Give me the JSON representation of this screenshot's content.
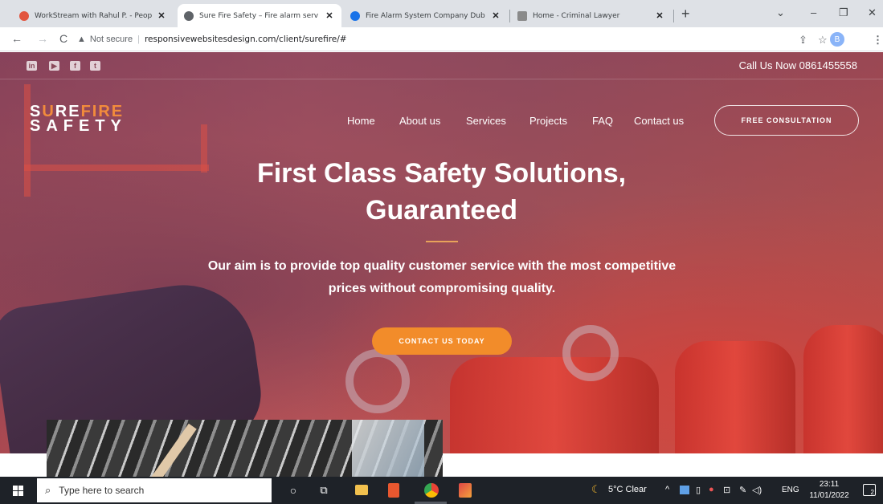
{
  "browser": {
    "tabs": [
      {
        "title": "WorkStream with Rahul P. - Peop",
        "favicon_color": "#e2553f",
        "active": false
      },
      {
        "title": "Sure Fire Safety – Fire alarm serv",
        "favicon_color": "#5f6368",
        "active": true
      },
      {
        "title": "Fire Alarm System Company Dub",
        "favicon_color": "#1a73e8",
        "active": false
      },
      {
        "title": "Home - Criminal Lawyer",
        "favicon_color": "#8a8a8a",
        "active": false
      }
    ],
    "close_glyph": "✕",
    "newtab_glyph": "+",
    "window_controls": {
      "dropdown": "⌄",
      "minimize": "–",
      "restore": "❐",
      "close": "✕"
    },
    "nav": {
      "back": "←",
      "forward": "→",
      "reload": "C"
    },
    "security_icon": "warning-triangle-icon",
    "security_glyph": "▲",
    "security_label": "Not secure",
    "url": "responsivewebsitesdesign.com/client/surefire/#",
    "share_glyph": "⇪",
    "star_glyph": "☆",
    "profile_initial": "B",
    "menu_glyph": "⋮"
  },
  "site": {
    "social_icons": [
      "in",
      "▶",
      "f",
      "t"
    ],
    "call_us": "Call Us Now 0861455558",
    "logo": {
      "line1_a": "S",
      "line1_b": "U",
      "line1_c": "RE",
      "line1_d": "FIRE",
      "line2": "SAFETY"
    },
    "nav": [
      "Home",
      "About us",
      "Services",
      "Projects",
      "FAQ",
      "Contact us"
    ],
    "consult_button": "FREE CONSULTATION",
    "headline_line1": "First Class Safety Solutions,",
    "headline_line2": "Guaranteed",
    "tagline_line1": "Our aim is to provide top quality customer service with the most competitive",
    "tagline_line2": "prices without compromising quality.",
    "cta_button": "CONTACT US TODAY"
  },
  "taskbar": {
    "search_placeholder": "Type here to search",
    "search_glyph": "⌕",
    "weather": "5°C  Clear",
    "weather_glyph": "☾",
    "lang": "ENG",
    "time": "23:11",
    "date": "11/01/2022",
    "notifications": "2",
    "tray_chevron": "^"
  },
  "colors": {
    "accent_orange": "#f28c2a",
    "logo_fire": "#f28b3c",
    "taskbar": "#1e2228"
  }
}
